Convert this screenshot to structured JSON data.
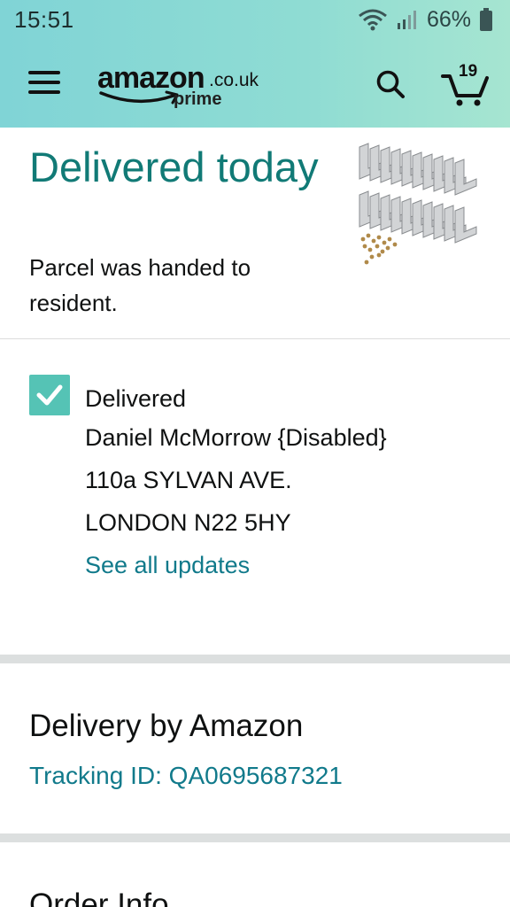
{
  "status_bar": {
    "time": "15:51",
    "battery": "66%",
    "icons": [
      "wifi-icon",
      "signal-icon",
      "battery-icon"
    ]
  },
  "header": {
    "logo": {
      "word": "amazon",
      "tld": ".co.uk",
      "prime": "prime"
    },
    "cart_count": "19",
    "icons": [
      "menu-icon",
      "search-icon",
      "cart-icon"
    ]
  },
  "delivery": {
    "title": "Delivered today",
    "subtitle": "Parcel was handed to resident.",
    "image_alt": "Metal corner brackets with screws"
  },
  "tracking_status": {
    "status": "Delivered",
    "recipient": "Daniel McMorrow {Disabled}",
    "address_line1": "110a SYLVAN AVE.",
    "address_line2": "LONDON N22 5HY",
    "see_updates_link": "See all updates"
  },
  "carrier": {
    "title": "Delivery by Amazon",
    "tracking_id": "Tracking ID: QA0695687321"
  },
  "order_info": {
    "title": "Order Info"
  },
  "colors": {
    "header_gradient_start": "#80d4d6",
    "header_gradient_end": "#a6e5d1",
    "title_teal": "#117a76",
    "link_teal": "#117a8b",
    "check_green": "#55c3b5"
  }
}
